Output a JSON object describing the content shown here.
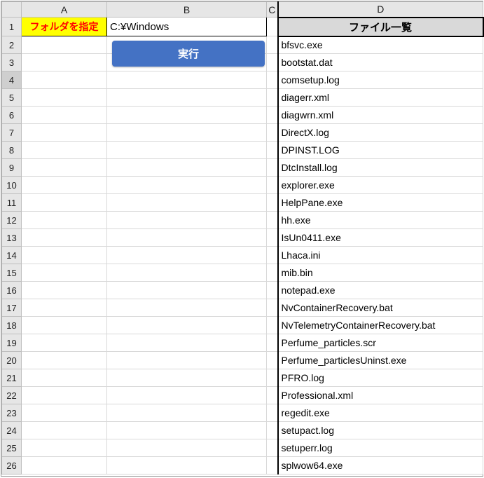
{
  "columns": {
    "A": "A",
    "B": "B",
    "C": "C",
    "D": "D"
  },
  "rowCount": 26,
  "selectedRow": 4,
  "cells": {
    "A1_label": "フォルダを指定",
    "B1_path": "C:¥Windows",
    "D1_header": "ファイル一覧"
  },
  "button": {
    "exec_label": "実行"
  },
  "filelist": [
    "bfsvc.exe",
    "bootstat.dat",
    "comsetup.log",
    "diagerr.xml",
    "diagwrn.xml",
    "DirectX.log",
    "DPINST.LOG",
    "DtcInstall.log",
    "explorer.exe",
    "HelpPane.exe",
    "hh.exe",
    "IsUn0411.exe",
    "Lhaca.ini",
    "mib.bin",
    "notepad.exe",
    "NvContainerRecovery.bat",
    "NvTelemetryContainerRecovery.bat",
    "Perfume_particles.scr",
    "Perfume_particlesUninst.exe",
    "PFRO.log",
    "Professional.xml",
    "regedit.exe",
    "setupact.log",
    "setuperr.log",
    "splwow64.exe"
  ]
}
